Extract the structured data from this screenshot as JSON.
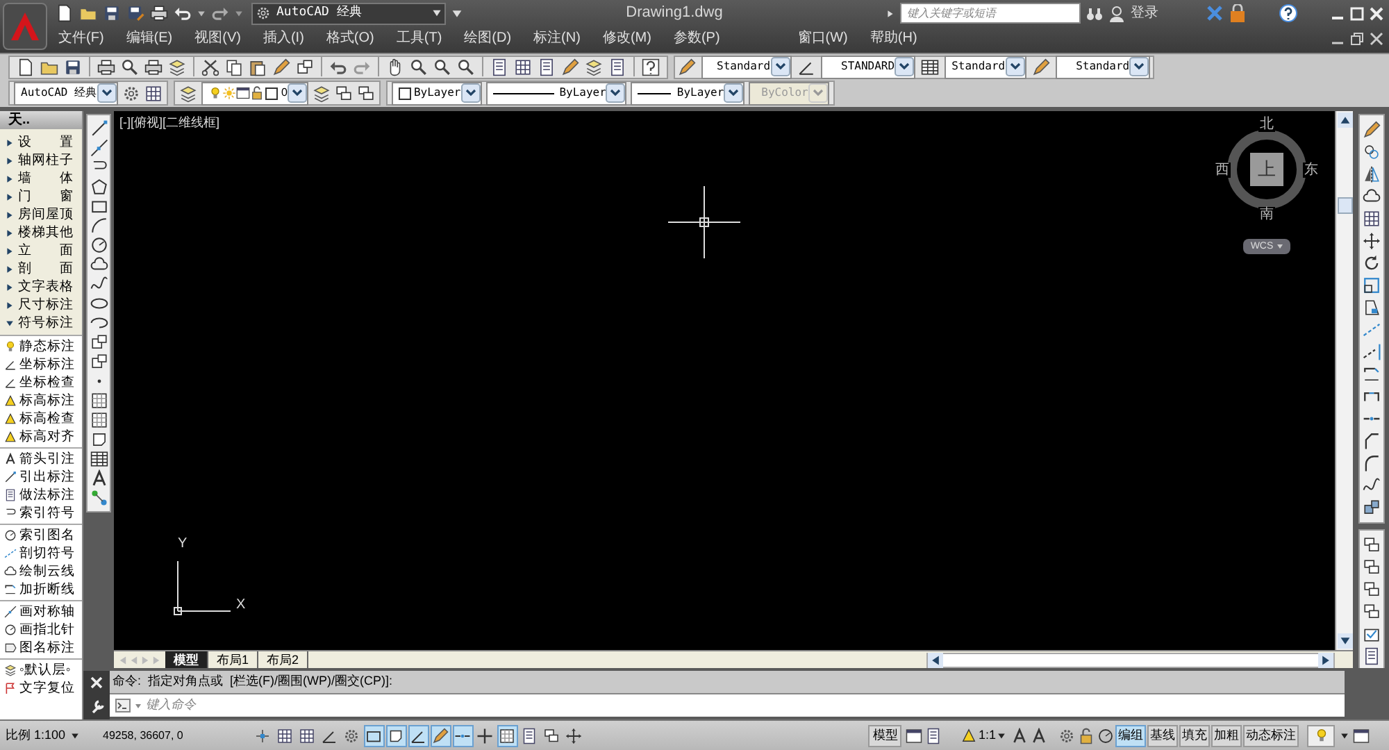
{
  "title_bar": {
    "workspace": "AutoCAD 经典",
    "document_title": "Drawing1.dwg",
    "search_placeholder": "键入关键字或短语",
    "sign_in": "登录"
  },
  "menu": [
    "文件(F)",
    "编辑(E)",
    "视图(V)",
    "插入(I)",
    "格式(O)",
    "工具(T)",
    "绘图(D)",
    "标注(N)",
    "修改(M)",
    "参数(P)",
    "窗口(W)",
    "帮助(H)"
  ],
  "toolbars": {
    "text_style": "Standard",
    "dimension_style": "STANDARD",
    "table_style": "Standard",
    "multileader_style": "Standard",
    "workspace": "AutoCAD 经典",
    "layer": "0",
    "color_control": "ByLayer",
    "linetype": "ByLayer",
    "lineweight": "ByLayer",
    "plot_style": {
      "value": "ByColor",
      "disabled": true
    }
  },
  "tool_palette": {
    "title": "天..",
    "categories": [
      {
        "label": "设　　置",
        "expanded": false
      },
      {
        "label": "轴网柱子",
        "expanded": false
      },
      {
        "label": "墙　　体",
        "expanded": false
      },
      {
        "label": "门　　窗",
        "expanded": false
      },
      {
        "label": "房间屋顶",
        "expanded": false
      },
      {
        "label": "楼梯其他",
        "expanded": false
      },
      {
        "label": "立　　面",
        "expanded": false
      },
      {
        "label": "剖　　面",
        "expanded": false
      },
      {
        "label": "文字表格",
        "expanded": false
      },
      {
        "label": "尺寸标注",
        "expanded": false
      },
      {
        "label": "符号标注",
        "expanded": true
      }
    ],
    "tool_groups": [
      [
        "静态标注",
        "坐标标注",
        "坐标检查",
        "标高标注",
        "标高检查",
        "标高对齐"
      ],
      [
        "箭头引注",
        "引出标注",
        "做法标注",
        "索引符号"
      ],
      [
        "索引图名",
        "剖切符号",
        "绘制云线",
        "加折断线"
      ],
      [
        "画对称轴",
        "画指北针",
        "图名标注"
      ],
      [
        "◦默认层◦",
        "文字复位"
      ]
    ]
  },
  "viewport": {
    "label": "[-][俯视][二维线框]",
    "viewcube": {
      "north": "北",
      "south": "南",
      "east": "东",
      "west": "西",
      "face": "上",
      "ucs": "WCS"
    },
    "ucs_axes": {
      "x": "X",
      "y": "Y"
    }
  },
  "layout_tabs": [
    {
      "label": "模型",
      "selected": true
    },
    {
      "label": "布局1",
      "selected": false
    },
    {
      "label": "布局2",
      "selected": false
    }
  ],
  "command_line": {
    "history": "命令:  指定对角点或  [栏选(F)/圈围(WP)/圈交(CP)]:",
    "placeholder": "键入命令"
  },
  "status_bar": {
    "scale": "比例 1:100",
    "coordinates": "49258, 36607, 0",
    "drafting_toggles": [
      {
        "on": false
      },
      {
        "on": false
      },
      {
        "on": false
      },
      {
        "on": false
      },
      {
        "on": false
      },
      {
        "on": true
      },
      {
        "on": true
      },
      {
        "on": true
      },
      {
        "on": true
      },
      {
        "on": true
      },
      {
        "on": false
      },
      {
        "on": true
      },
      {
        "on": false
      },
      {
        "on": false
      },
      {
        "on": false
      }
    ],
    "model": "模型",
    "annotation_scale": "1:1",
    "mode_buttons": [
      {
        "label": "编组",
        "on": true
      },
      {
        "label": "基线",
        "on": false
      },
      {
        "label": "填充",
        "on": false
      },
      {
        "label": "加粗",
        "on": false
      },
      {
        "label": "动态标注",
        "on": false
      }
    ]
  }
}
